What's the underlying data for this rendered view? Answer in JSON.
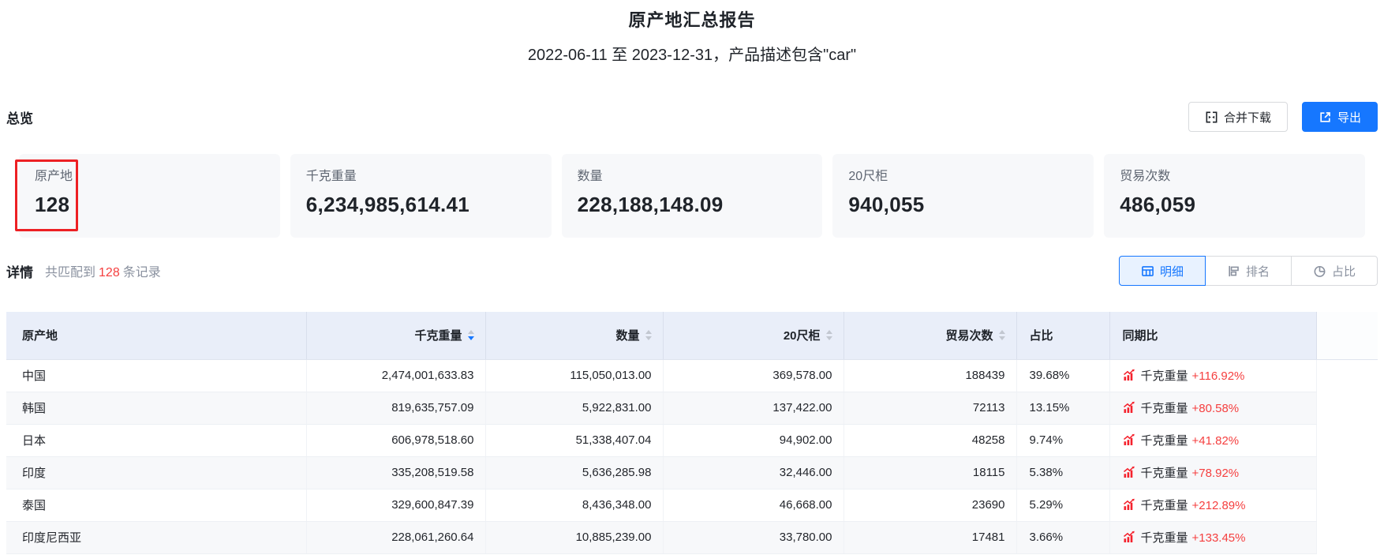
{
  "report": {
    "title": "原产地汇总报告",
    "subtitle": "2022-06-11 至 2023-12-31，产品描述包含\"car\""
  },
  "overview": {
    "heading": "总览",
    "merge_download_label": "合并下载",
    "export_label": "导出",
    "cards": [
      {
        "label": "原产地",
        "value": "128",
        "highlighted": true
      },
      {
        "label": "千克重量",
        "value": "6,234,985,614.41"
      },
      {
        "label": "数量",
        "value": "228,188,148.09"
      },
      {
        "label": "20尺柜",
        "value": "940,055"
      },
      {
        "label": "贸易次数",
        "value": "486,059"
      }
    ]
  },
  "details": {
    "heading": "详情",
    "match_prefix": "共匹配到",
    "match_count": "128",
    "match_suffix": "条记录",
    "tabs": [
      {
        "label": "明细",
        "icon": "table-icon",
        "active": true
      },
      {
        "label": "排名",
        "icon": "ranking-icon",
        "active": false
      },
      {
        "label": "占比",
        "icon": "pie-icon",
        "active": false
      }
    ]
  },
  "table": {
    "columns": [
      {
        "label": "原产地",
        "align": "left",
        "sortable": false,
        "sort": null
      },
      {
        "label": "千克重量",
        "align": "right",
        "sortable": true,
        "sort": "desc"
      },
      {
        "label": "数量",
        "align": "right",
        "sortable": true,
        "sort": null
      },
      {
        "label": "20尺柜",
        "align": "right",
        "sortable": true,
        "sort": null
      },
      {
        "label": "贸易次数",
        "align": "right",
        "sortable": true,
        "sort": null
      },
      {
        "label": "占比",
        "align": "left",
        "sortable": false,
        "sort": null
      },
      {
        "label": "同期比",
        "align": "left",
        "sortable": false,
        "sort": null
      },
      {
        "label": "",
        "align": "left",
        "sortable": false,
        "sort": null
      }
    ],
    "rows": [
      {
        "origin": "中国",
        "weight": "2,474,001,633.83",
        "quantity": "115,050,013.00",
        "teu": "369,578.00",
        "trades": "188439",
        "share": "39.68%",
        "yoy_metric": "千克重量",
        "yoy_change": "+116.92%"
      },
      {
        "origin": "韩国",
        "weight": "819,635,757.09",
        "quantity": "5,922,831.00",
        "teu": "137,422.00",
        "trades": "72113",
        "share": "13.15%",
        "yoy_metric": "千克重量",
        "yoy_change": "+80.58%"
      },
      {
        "origin": "日本",
        "weight": "606,978,518.60",
        "quantity": "51,338,407.04",
        "teu": "94,902.00",
        "trades": "48258",
        "share": "9.74%",
        "yoy_metric": "千克重量",
        "yoy_change": "+41.82%"
      },
      {
        "origin": "印度",
        "weight": "335,208,519.58",
        "quantity": "5,636,285.98",
        "teu": "32,446.00",
        "trades": "18115",
        "share": "5.38%",
        "yoy_metric": "千克重量",
        "yoy_change": "+78.92%"
      },
      {
        "origin": "泰国",
        "weight": "329,600,847.39",
        "quantity": "8,436,348.00",
        "teu": "46,668.00",
        "trades": "23690",
        "share": "5.29%",
        "yoy_metric": "千克重量",
        "yoy_change": "+212.89%"
      },
      {
        "origin": "印度尼西亚",
        "weight": "228,061,260.64",
        "quantity": "10,885,239.00",
        "teu": "33,780.00",
        "trades": "17481",
        "share": "3.66%",
        "yoy_metric": "千克重量",
        "yoy_change": "+133.45%"
      }
    ]
  },
  "colors": {
    "accent_blue": "#1677ff",
    "alert_red": "#f53f3f",
    "annotation_red": "#ed2024",
    "table_header_bg": "#e9eef9",
    "card_bg": "#f7f8fa"
  }
}
